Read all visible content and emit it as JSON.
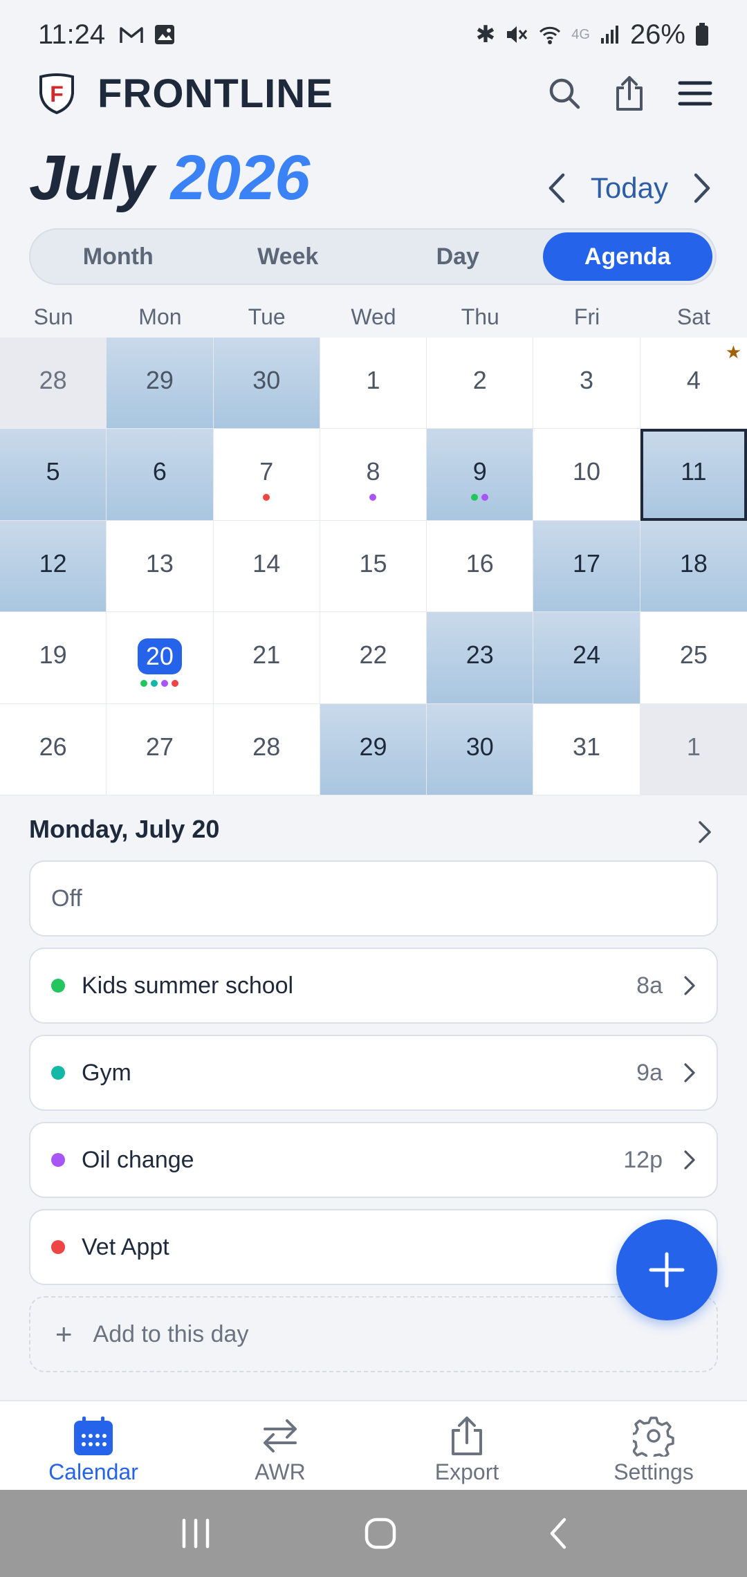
{
  "status_bar": {
    "time": "11:24",
    "battery": "26%",
    "network": "4G"
  },
  "app": {
    "brand": "FRONTLINE",
    "logo_letter": "F"
  },
  "title": {
    "month": "July",
    "year": "2026"
  },
  "nav": {
    "today_label": "Today"
  },
  "view_tabs": [
    {
      "label": "Month",
      "active": false
    },
    {
      "label": "Week",
      "active": false
    },
    {
      "label": "Day",
      "active": false
    },
    {
      "label": "Agenda",
      "active": true
    }
  ],
  "weekdays": [
    "Sun",
    "Mon",
    "Tue",
    "Wed",
    "Thu",
    "Fri",
    "Sat"
  ],
  "calendar": {
    "days": [
      {
        "n": "28",
        "other": true,
        "shaded": false,
        "dots": []
      },
      {
        "n": "29",
        "other": true,
        "shaded": true,
        "dots": []
      },
      {
        "n": "30",
        "other": true,
        "shaded": true,
        "dots": []
      },
      {
        "n": "1",
        "shaded": false,
        "dots": []
      },
      {
        "n": "2",
        "shaded": false,
        "dots": []
      },
      {
        "n": "3",
        "shaded": false,
        "dots": []
      },
      {
        "n": "4",
        "shaded": false,
        "dots": [],
        "star": true
      },
      {
        "n": "5",
        "shaded": true,
        "dots": []
      },
      {
        "n": "6",
        "shaded": true,
        "dots": []
      },
      {
        "n": "7",
        "shaded": false,
        "dots": [
          "#ef4444"
        ]
      },
      {
        "n": "8",
        "shaded": false,
        "dots": [
          "#a855f7"
        ]
      },
      {
        "n": "9",
        "shaded": true,
        "dots": [
          "#22c55e",
          "#a855f7"
        ]
      },
      {
        "n": "10",
        "shaded": false,
        "dots": []
      },
      {
        "n": "11",
        "shaded": true,
        "dots": [],
        "selected": true
      },
      {
        "n": "12",
        "shaded": true,
        "dots": []
      },
      {
        "n": "13",
        "shaded": false,
        "dots": []
      },
      {
        "n": "14",
        "shaded": false,
        "dots": []
      },
      {
        "n": "15",
        "shaded": false,
        "dots": []
      },
      {
        "n": "16",
        "shaded": false,
        "dots": []
      },
      {
        "n": "17",
        "shaded": true,
        "dots": []
      },
      {
        "n": "18",
        "shaded": true,
        "dots": []
      },
      {
        "n": "19",
        "shaded": false,
        "dots": []
      },
      {
        "n": "20",
        "shaded": false,
        "today": true,
        "dots": [
          "#22c55e",
          "#14b8a6",
          "#a855f7",
          "#ef4444"
        ]
      },
      {
        "n": "21",
        "shaded": false,
        "dots": []
      },
      {
        "n": "22",
        "shaded": false,
        "dots": []
      },
      {
        "n": "23",
        "shaded": true,
        "dots": []
      },
      {
        "n": "24",
        "shaded": true,
        "dots": []
      },
      {
        "n": "25",
        "shaded": false,
        "dots": []
      },
      {
        "n": "26",
        "shaded": false,
        "dots": []
      },
      {
        "n": "27",
        "shaded": false,
        "dots": []
      },
      {
        "n": "28",
        "shaded": false,
        "dots": []
      },
      {
        "n": "29",
        "shaded": true,
        "dots": []
      },
      {
        "n": "30",
        "shaded": true,
        "dots": []
      },
      {
        "n": "31",
        "shaded": false,
        "dots": []
      },
      {
        "n": "1",
        "other": true,
        "shaded": false,
        "dots": []
      }
    ]
  },
  "agenda": {
    "day_title": "Monday, July 20",
    "off_label": "Off",
    "events": [
      {
        "title": "Kids summer school",
        "time": "8a",
        "color": "#22c55e"
      },
      {
        "title": "Gym",
        "time": "9a",
        "color": "#14b8a6"
      },
      {
        "title": "Oil change",
        "time": "12p",
        "color": "#a855f7"
      },
      {
        "title": "Vet Appt",
        "time": "",
        "color": "#ef4444"
      }
    ],
    "add_label": "Add to this day"
  },
  "bottom_nav": [
    {
      "label": "Calendar",
      "icon": "calendar-icon",
      "active": true
    },
    {
      "label": "AWR",
      "icon": "swap-icon",
      "active": false
    },
    {
      "label": "Export",
      "icon": "export-icon",
      "active": false
    },
    {
      "label": "Settings",
      "icon": "gear-icon",
      "active": false
    }
  ],
  "colors": {
    "accent": "#2563eb",
    "shaded": "#b3cce4",
    "text": "#1e2a3b"
  }
}
